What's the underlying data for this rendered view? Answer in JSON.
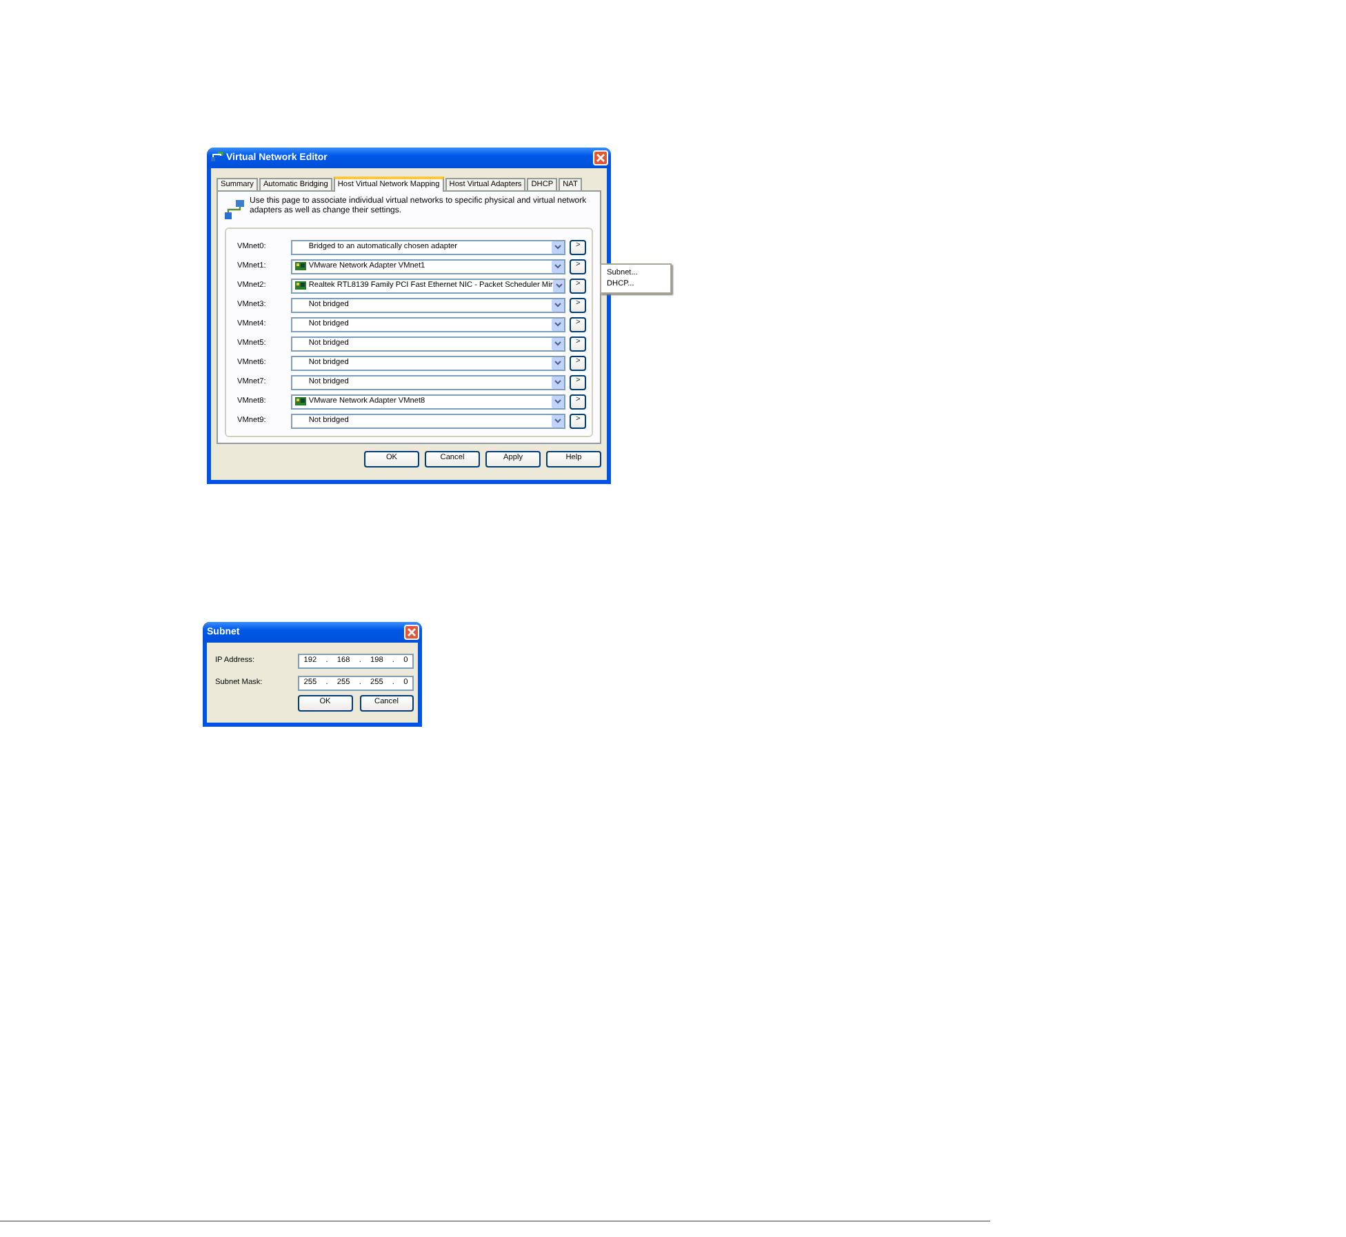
{
  "editor": {
    "title": "Virtual Network Editor",
    "tabs": [
      {
        "label": "Summary",
        "selected": false
      },
      {
        "label": "Automatic Bridging",
        "selected": false
      },
      {
        "label": "Host Virtual Network Mapping",
        "selected": true
      },
      {
        "label": "Host Virtual Adapters",
        "selected": false
      },
      {
        "label": "DHCP",
        "selected": false
      },
      {
        "label": "NAT",
        "selected": false
      }
    ],
    "description": "Use this page to associate individual virtual networks to specific physical and virtual network adapters as well as change their settings.",
    "rows": [
      {
        "label": "VMnet0:",
        "value": "Bridged to an automatically chosen adapter",
        "kind": "plain"
      },
      {
        "label": "VMnet1:",
        "value": "VMware Network Adapter VMnet1",
        "kind": "adapter"
      },
      {
        "label": "VMnet2:",
        "value": "Realtek RTL8139 Family PCI Fast Ethernet NIC - Packet Scheduler Mir",
        "kind": "adapter"
      },
      {
        "label": "VMnet3:",
        "value": "Not bridged",
        "kind": "plain"
      },
      {
        "label": "VMnet4:",
        "value": "Not bridged",
        "kind": "plain"
      },
      {
        "label": "VMnet5:",
        "value": "Not bridged",
        "kind": "plain"
      },
      {
        "label": "VMnet6:",
        "value": "Not bridged",
        "kind": "plain"
      },
      {
        "label": "VMnet7:",
        "value": "Not bridged",
        "kind": "plain"
      },
      {
        "label": "VMnet8:",
        "value": "VMware Network Adapter VMnet8",
        "kind": "adapter"
      },
      {
        "label": "VMnet9:",
        "value": "Not bridged",
        "kind": "plain"
      }
    ],
    "row_button": ">",
    "context_menu": [
      "Subnet...",
      "DHCP..."
    ],
    "buttons": [
      "OK",
      "Cancel",
      "Apply",
      "Help"
    ]
  },
  "subnet": {
    "title": "Subnet",
    "fields": [
      {
        "label": "IP Address:",
        "octets": [
          "192",
          "168",
          "198",
          "0"
        ],
        "separator": "."
      },
      {
        "label": "Subnet Mask:",
        "octets": [
          "255",
          "255",
          "255",
          "0"
        ],
        "separator": "."
      }
    ],
    "buttons": [
      "OK",
      "Cancel"
    ]
  }
}
